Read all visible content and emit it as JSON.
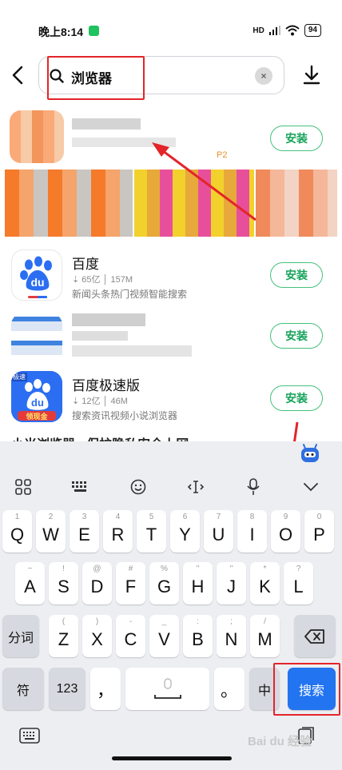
{
  "status_bar": {
    "time": "晚上8:14",
    "network": "HD",
    "battery": "94"
  },
  "search": {
    "query": "浏览器",
    "clear_label": "×"
  },
  "results": [
    {
      "name": "",
      "sub_label": "P2",
      "install_label": "安装"
    },
    {
      "name": "百度",
      "meta": "⇣ 65亿 │ 157M",
      "desc": "新闻头条热门视频智能搜索",
      "install_label": "安装"
    },
    {
      "name": "",
      "install_label": "安装"
    },
    {
      "name": "百度极速版",
      "meta": "⇣ 12亿 │ 46M",
      "desc": "搜索资讯视频小说浏览器",
      "install_label": "安装",
      "icon_badges": [
        "极速",
        "领现金"
      ]
    }
  ],
  "next_result_partial": "小米浏览器 - 保护隐私安全上网",
  "keyboard": {
    "row1": [
      {
        "hint": "1",
        "key": "Q"
      },
      {
        "hint": "2",
        "key": "W"
      },
      {
        "hint": "3",
        "key": "E"
      },
      {
        "hint": "4",
        "key": "R"
      },
      {
        "hint": "5",
        "key": "T"
      },
      {
        "hint": "6",
        "key": "Y"
      },
      {
        "hint": "7",
        "key": "U"
      },
      {
        "hint": "8",
        "key": "I"
      },
      {
        "hint": "9",
        "key": "O"
      },
      {
        "hint": "0",
        "key": "P"
      }
    ],
    "row2": [
      {
        "hint": "~",
        "key": "A"
      },
      {
        "hint": "!",
        "key": "S"
      },
      {
        "hint": "@",
        "key": "D"
      },
      {
        "hint": "#",
        "key": "F"
      },
      {
        "hint": "%",
        "key": "G"
      },
      {
        "hint": "\"",
        "key": "H"
      },
      {
        "hint": "\"",
        "key": "J"
      },
      {
        "hint": "*",
        "key": "K"
      },
      {
        "hint": "?",
        "key": "L"
      }
    ],
    "row3": [
      {
        "hint": "(",
        "key": "Z"
      },
      {
        "hint": ")",
        "key": "X"
      },
      {
        "hint": "-",
        "key": "C"
      },
      {
        "hint": "_",
        "key": "V"
      },
      {
        "hint": ":",
        "key": "B"
      },
      {
        "hint": ";",
        "key": "N"
      },
      {
        "hint": "/",
        "key": "M"
      }
    ],
    "fenci": "分词",
    "symbols": "符",
    "numbers": "123",
    "comma": "，",
    "period": "。",
    "lang": "中",
    "search_key": "搜索"
  },
  "watermark": "Bai du 经验",
  "colors": {
    "install_green": "#16a35a",
    "search_key_blue": "#2274f0",
    "highlight_red": "#e3252a"
  }
}
